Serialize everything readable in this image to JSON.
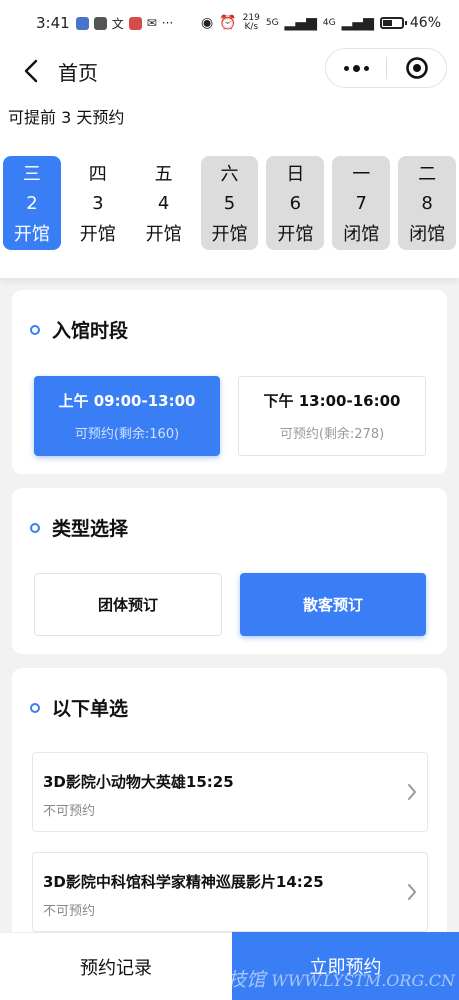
{
  "statusbar": {
    "time": "3:41",
    "speed_value": "219",
    "speed_unit": "K/s",
    "net1": "5G",
    "net2": "4G",
    "battery": "46%"
  },
  "navbar": {
    "title": "首页"
  },
  "advance_note": "可提前 3 天预约",
  "dates": [
    {
      "weekday": "三",
      "day": "2",
      "status": "开馆",
      "state": "selected"
    },
    {
      "weekday": "四",
      "day": "3",
      "status": "开馆",
      "state": "normal"
    },
    {
      "weekday": "五",
      "day": "4",
      "status": "开馆",
      "state": "normal"
    },
    {
      "weekday": "六",
      "day": "5",
      "status": "开馆",
      "state": "weekend"
    },
    {
      "weekday": "日",
      "day": "6",
      "status": "开馆",
      "state": "weekend"
    },
    {
      "weekday": "一",
      "day": "7",
      "status": "闭馆",
      "state": "closed"
    },
    {
      "weekday": "二",
      "day": "8",
      "status": "闭馆",
      "state": "closed"
    }
  ],
  "entry_section": {
    "title": "入馆时段",
    "slots": [
      {
        "label": "上午 09:00-13:00",
        "sub": "可预约(剩余:160)",
        "active": true
      },
      {
        "label": "下午 13:00-16:00",
        "sub": "可预约(剩余:278)",
        "active": false
      }
    ]
  },
  "type_section": {
    "title": "类型选择",
    "options": [
      {
        "label": "团体预订",
        "active": false
      },
      {
        "label": "散客预订",
        "active": true
      }
    ]
  },
  "choice_section": {
    "title": "以下单选",
    "items": [
      {
        "title": "3D影院小动物大英雄15:25",
        "sub": "不可预约"
      },
      {
        "title": "3D影院中科馆科学家精神巡展影片14:25",
        "sub": "不可预约"
      }
    ]
  },
  "bottom": {
    "records": "预约记录",
    "book_now": "立即预约",
    "watermark_cn": "临沂市科技馆",
    "watermark_url": "WWW.LYSTM.ORG.CN"
  },
  "colors": {
    "accent": "#3a7ef6",
    "bg": "#f2f2f2",
    "closed_bg": "#dcdcdc"
  }
}
